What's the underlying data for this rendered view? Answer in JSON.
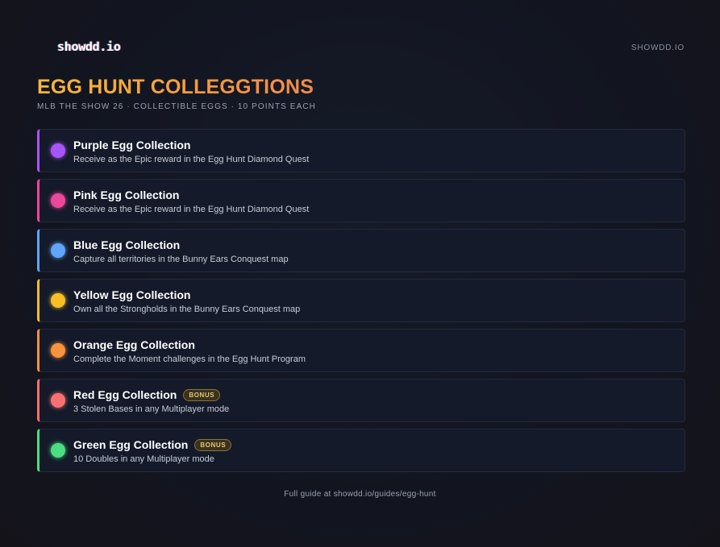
{
  "header": {
    "logo": "showdd.io",
    "site_label": "SHOWDD.IO"
  },
  "page": {
    "title": "EGG HUNT COLLEGGTIONS",
    "subtitle": "MLB THE SHOW 26 · COLLECTIBLE EGGS · 10 POINTS EACH"
  },
  "collections": [
    {
      "title": "Purple Egg Collection",
      "description": "Receive as the Epic reward in the Egg Hunt Diamond Quest",
      "color": "#a855f7",
      "badge": ""
    },
    {
      "title": "Pink Egg Collection",
      "description": "Receive as the Epic reward in the Egg Hunt Diamond Quest",
      "color": "#ec4899",
      "badge": ""
    },
    {
      "title": "Blue Egg Collection",
      "description": "Capture all territories in the Bunny Ears Conquest map",
      "color": "#60a5fa",
      "badge": ""
    },
    {
      "title": "Yellow Egg Collection",
      "description": "Own all the Strongholds in the Bunny Ears Conquest map",
      "color": "#fbbf24",
      "badge": ""
    },
    {
      "title": "Orange Egg Collection",
      "description": "Complete the Moment challenges in the Egg Hunt Program",
      "color": "#fb923c",
      "badge": ""
    },
    {
      "title": "Red Egg Collection",
      "description": "3 Stolen Bases in any Multiplayer mode",
      "color": "#f87171",
      "badge": "BONUS"
    },
    {
      "title": "Green Egg Collection",
      "description": "10 Doubles in any Multiplayer mode",
      "color": "#4ade80",
      "badge": "BONUS"
    }
  ],
  "footer": {
    "text": "Full guide at showdd.io/guides/egg-hunt"
  }
}
